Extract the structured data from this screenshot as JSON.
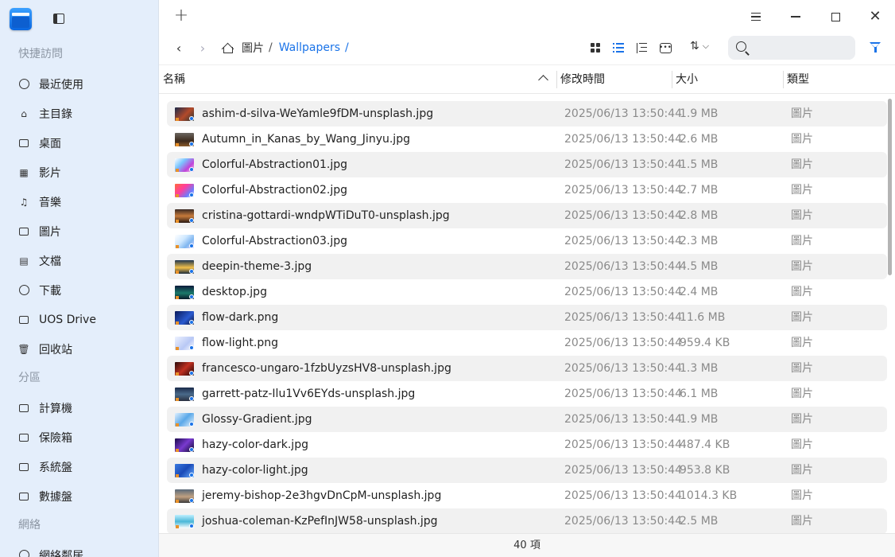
{
  "sidebar": {
    "sections": {
      "quick": "快捷訪問",
      "partitions": "分區",
      "network": "網絡"
    },
    "items": {
      "recent": "最近使用",
      "home": "主目錄",
      "desktop": "桌面",
      "videos": "影片",
      "music": "音樂",
      "pictures": "圖片",
      "documents": "文檔",
      "downloads": "下載",
      "uos_drive": "UOS Drive",
      "trash": "回收站",
      "computer": "計算機",
      "vault": "保險箱",
      "system_disk": "系統盤",
      "data_disk": "數據盤",
      "network_neighborhood": "網絡鄰居"
    }
  },
  "header": {
    "new_tab": "+",
    "back": "‹",
    "forward": "›",
    "sort": "⇅",
    "search_placeholder": "",
    "breadcrumbs": [
      "圖片",
      "/",
      "Wallpapers",
      "/"
    ]
  },
  "columns": {
    "name": "名稱",
    "modified": "修改時間",
    "size": "大小",
    "type": "類型"
  },
  "files": [
    {
      "name": "ashim-d-silva-WeYamle9fDM-unsplash.jpg",
      "modified": "2025/06/13 13:50:44",
      "size": "1.9 MB",
      "type": "圖片",
      "thumb": "linear-gradient(135deg,#1b2a4a,#b44a2a 55%,#233)"
    },
    {
      "name": "Autumn_in_Kanas_by_Wang_Jinyu.jpg",
      "modified": "2025/06/13 13:50:44",
      "size": "2.6 MB",
      "type": "圖片",
      "thumb": "linear-gradient(180deg,#6b6660,#3d2a1c 60%,#8a5a2a)"
    },
    {
      "name": "Colorful-Abstraction01.jpg",
      "modified": "2025/06/13 13:50:44",
      "size": "1.5 MB",
      "type": "圖片",
      "thumb": "linear-gradient(135deg,#ffffff,#7ac6ff 35%,#c043d8 70%,#ffd7f0)"
    },
    {
      "name": "Colorful-Abstraction02.jpg",
      "modified": "2025/06/13 13:50:44",
      "size": "2.7 MB",
      "type": "圖片",
      "thumb": "linear-gradient(135deg,#ff6a3d,#ff3d9e 40%,#6a7dff 75%,#ffffff)"
    },
    {
      "name": "cristina-gottardi-wndpWTiDuT0-unsplash.jpg",
      "modified": "2025/06/13 13:50:44",
      "size": "2.8 MB",
      "type": "圖片",
      "thumb": "linear-gradient(180deg,#3a2a24,#c77a3a 50%,#2a1a14)"
    },
    {
      "name": "Colorful-Abstraction03.jpg",
      "modified": "2025/06/13 13:50:44",
      "size": "2.3 MB",
      "type": "圖片",
      "thumb": "linear-gradient(135deg,#ffffff,#cfe8ff 40%,#7fb6f0 70%,#e8d5ff)"
    },
    {
      "name": "deepin-theme-3.jpg",
      "modified": "2025/06/13 13:50:44",
      "size": "4.5 MB",
      "type": "圖片",
      "thumb": "linear-gradient(180deg,#1d3550,#f2c04a 55%,#1a2a3a)"
    },
    {
      "name": "desktop.jpg",
      "modified": "2025/06/13 13:50:44",
      "size": "2.4 MB",
      "type": "圖片",
      "thumb": "linear-gradient(180deg,#0c1a3a,#1a7a6a 55%,#0a1a2a)"
    },
    {
      "name": "flow-dark.png",
      "modified": "2025/06/13 13:50:44",
      "size": "11.6 MB",
      "type": "圖片",
      "thumb": "linear-gradient(135deg,#0a1a5a,#2a5ad0 60%,#0a1030)"
    },
    {
      "name": "flow-light.png",
      "modified": "2025/06/13 13:50:44",
      "size": "959.4 KB",
      "type": "圖片",
      "thumb": "linear-gradient(135deg,#eef2ff,#b8c8f5 60%,#ffffff)"
    },
    {
      "name": "francesco-ungaro-1fzbUyzsHV8-unsplash.jpg",
      "modified": "2025/06/13 13:50:44",
      "size": "1.3 MB",
      "type": "圖片",
      "thumb": "linear-gradient(135deg,#2a0a0a,#c03020 50%,#1a0505)"
    },
    {
      "name": "garrett-patz-Ilu1Vv6EYds-unsplash.jpg",
      "modified": "2025/06/13 13:50:44",
      "size": "6.1 MB",
      "type": "圖片",
      "thumb": "linear-gradient(180deg,#1a2a4a,#4a6a8a 50%,#2a3040)"
    },
    {
      "name": "Glossy-Gradient.jpg",
      "modified": "2025/06/13 13:50:44",
      "size": "1.9 MB",
      "type": "圖片",
      "thumb": "linear-gradient(135deg,#dff0ff,#5aa8e8 50%,#eaf6ff)"
    },
    {
      "name": "hazy-color-dark.jpg",
      "modified": "2025/06/13 13:50:44",
      "size": "487.4 KB",
      "type": "圖片",
      "thumb": "linear-gradient(135deg,#1a0a4a,#7a3ad0 50%,#0a0a2a)"
    },
    {
      "name": "hazy-color-light.jpg",
      "modified": "2025/06/13 13:50:44",
      "size": "953.8 KB",
      "type": "圖片",
      "thumb": "linear-gradient(135deg,#3a7ae0,#1a4ab8 50%,#6ab0ff)"
    },
    {
      "name": "jeremy-bishop-2e3hgvDnCpM-unsplash.jpg",
      "modified": "2025/06/13 13:50:44",
      "size": "1014.3 KB",
      "type": "圖片",
      "thumb": "linear-gradient(180deg,#5a6a7a,#c0a080 55%,#3a3a3a)"
    },
    {
      "name": "joshua-coleman-KzPefInJW58-unsplash.jpg",
      "modified": "2025/06/13 13:50:44",
      "size": "2.5 MB",
      "type": "圖片",
      "thumb": "linear-gradient(180deg,#bfefff,#4ab8d8 50%,#ffffff)"
    }
  ],
  "status": {
    "count": "40 項"
  }
}
